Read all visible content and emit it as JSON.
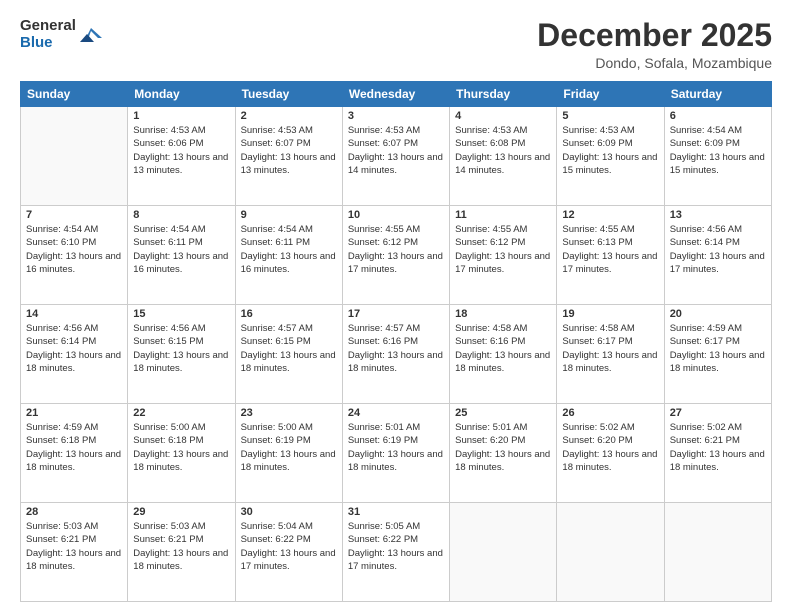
{
  "header": {
    "logo_general": "General",
    "logo_blue": "Blue",
    "month_title": "December 2025",
    "location": "Dondo, Sofala, Mozambique"
  },
  "weekdays": [
    "Sunday",
    "Monday",
    "Tuesday",
    "Wednesday",
    "Thursday",
    "Friday",
    "Saturday"
  ],
  "days": [
    {
      "num": "",
      "sunrise": "",
      "sunset": "",
      "daylight": ""
    },
    {
      "num": "1",
      "sunrise": "Sunrise: 4:53 AM",
      "sunset": "Sunset: 6:06 PM",
      "daylight": "Daylight: 13 hours and 13 minutes."
    },
    {
      "num": "2",
      "sunrise": "Sunrise: 4:53 AM",
      "sunset": "Sunset: 6:07 PM",
      "daylight": "Daylight: 13 hours and 13 minutes."
    },
    {
      "num": "3",
      "sunrise": "Sunrise: 4:53 AM",
      "sunset": "Sunset: 6:07 PM",
      "daylight": "Daylight: 13 hours and 14 minutes."
    },
    {
      "num": "4",
      "sunrise": "Sunrise: 4:53 AM",
      "sunset": "Sunset: 6:08 PM",
      "daylight": "Daylight: 13 hours and 14 minutes."
    },
    {
      "num": "5",
      "sunrise": "Sunrise: 4:53 AM",
      "sunset": "Sunset: 6:09 PM",
      "daylight": "Daylight: 13 hours and 15 minutes."
    },
    {
      "num": "6",
      "sunrise": "Sunrise: 4:54 AM",
      "sunset": "Sunset: 6:09 PM",
      "daylight": "Daylight: 13 hours and 15 minutes."
    },
    {
      "num": "7",
      "sunrise": "Sunrise: 4:54 AM",
      "sunset": "Sunset: 6:10 PM",
      "daylight": "Daylight: 13 hours and 16 minutes."
    },
    {
      "num": "8",
      "sunrise": "Sunrise: 4:54 AM",
      "sunset": "Sunset: 6:11 PM",
      "daylight": "Daylight: 13 hours and 16 minutes."
    },
    {
      "num": "9",
      "sunrise": "Sunrise: 4:54 AM",
      "sunset": "Sunset: 6:11 PM",
      "daylight": "Daylight: 13 hours and 16 minutes."
    },
    {
      "num": "10",
      "sunrise": "Sunrise: 4:55 AM",
      "sunset": "Sunset: 6:12 PM",
      "daylight": "Daylight: 13 hours and 17 minutes."
    },
    {
      "num": "11",
      "sunrise": "Sunrise: 4:55 AM",
      "sunset": "Sunset: 6:12 PM",
      "daylight": "Daylight: 13 hours and 17 minutes."
    },
    {
      "num": "12",
      "sunrise": "Sunrise: 4:55 AM",
      "sunset": "Sunset: 6:13 PM",
      "daylight": "Daylight: 13 hours and 17 minutes."
    },
    {
      "num": "13",
      "sunrise": "Sunrise: 4:56 AM",
      "sunset": "Sunset: 6:14 PM",
      "daylight": "Daylight: 13 hours and 17 minutes."
    },
    {
      "num": "14",
      "sunrise": "Sunrise: 4:56 AM",
      "sunset": "Sunset: 6:14 PM",
      "daylight": "Daylight: 13 hours and 18 minutes."
    },
    {
      "num": "15",
      "sunrise": "Sunrise: 4:56 AM",
      "sunset": "Sunset: 6:15 PM",
      "daylight": "Daylight: 13 hours and 18 minutes."
    },
    {
      "num": "16",
      "sunrise": "Sunrise: 4:57 AM",
      "sunset": "Sunset: 6:15 PM",
      "daylight": "Daylight: 13 hours and 18 minutes."
    },
    {
      "num": "17",
      "sunrise": "Sunrise: 4:57 AM",
      "sunset": "Sunset: 6:16 PM",
      "daylight": "Daylight: 13 hours and 18 minutes."
    },
    {
      "num": "18",
      "sunrise": "Sunrise: 4:58 AM",
      "sunset": "Sunset: 6:16 PM",
      "daylight": "Daylight: 13 hours and 18 minutes."
    },
    {
      "num": "19",
      "sunrise": "Sunrise: 4:58 AM",
      "sunset": "Sunset: 6:17 PM",
      "daylight": "Daylight: 13 hours and 18 minutes."
    },
    {
      "num": "20",
      "sunrise": "Sunrise: 4:59 AM",
      "sunset": "Sunset: 6:17 PM",
      "daylight": "Daylight: 13 hours and 18 minutes."
    },
    {
      "num": "21",
      "sunrise": "Sunrise: 4:59 AM",
      "sunset": "Sunset: 6:18 PM",
      "daylight": "Daylight: 13 hours and 18 minutes."
    },
    {
      "num": "22",
      "sunrise": "Sunrise: 5:00 AM",
      "sunset": "Sunset: 6:18 PM",
      "daylight": "Daylight: 13 hours and 18 minutes."
    },
    {
      "num": "23",
      "sunrise": "Sunrise: 5:00 AM",
      "sunset": "Sunset: 6:19 PM",
      "daylight": "Daylight: 13 hours and 18 minutes."
    },
    {
      "num": "24",
      "sunrise": "Sunrise: 5:01 AM",
      "sunset": "Sunset: 6:19 PM",
      "daylight": "Daylight: 13 hours and 18 minutes."
    },
    {
      "num": "25",
      "sunrise": "Sunrise: 5:01 AM",
      "sunset": "Sunset: 6:20 PM",
      "daylight": "Daylight: 13 hours and 18 minutes."
    },
    {
      "num": "26",
      "sunrise": "Sunrise: 5:02 AM",
      "sunset": "Sunset: 6:20 PM",
      "daylight": "Daylight: 13 hours and 18 minutes."
    },
    {
      "num": "27",
      "sunrise": "Sunrise: 5:02 AM",
      "sunset": "Sunset: 6:21 PM",
      "daylight": "Daylight: 13 hours and 18 minutes."
    },
    {
      "num": "28",
      "sunrise": "Sunrise: 5:03 AM",
      "sunset": "Sunset: 6:21 PM",
      "daylight": "Daylight: 13 hours and 18 minutes."
    },
    {
      "num": "29",
      "sunrise": "Sunrise: 5:03 AM",
      "sunset": "Sunset: 6:21 PM",
      "daylight": "Daylight: 13 hours and 18 minutes."
    },
    {
      "num": "30",
      "sunrise": "Sunrise: 5:04 AM",
      "sunset": "Sunset: 6:22 PM",
      "daylight": "Daylight: 13 hours and 17 minutes."
    },
    {
      "num": "31",
      "sunrise": "Sunrise: 5:05 AM",
      "sunset": "Sunset: 6:22 PM",
      "daylight": "Daylight: 13 hours and 17 minutes."
    }
  ]
}
